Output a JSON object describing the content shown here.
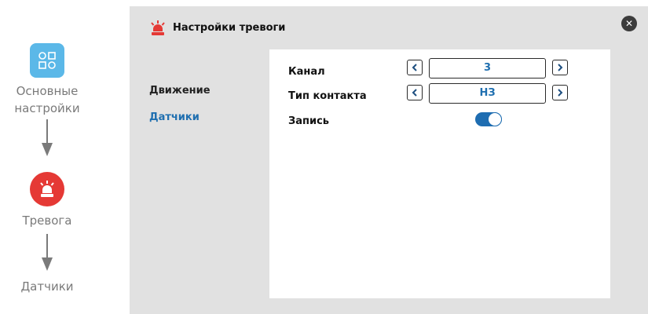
{
  "flow": {
    "steps": [
      {
        "label_line1": "Основные",
        "label_line2": "настройки",
        "icon": "settings-grid-icon"
      },
      {
        "label": "Тревога",
        "icon": "siren-icon"
      },
      {
        "label": "Датчики"
      }
    ]
  },
  "dialog": {
    "title": "Настройки тревоги",
    "title_icon": "siren-icon",
    "close_icon": "close-icon"
  },
  "menu": {
    "items": [
      {
        "label": "Движение",
        "active": false
      },
      {
        "label": "Датчики",
        "active": true
      }
    ]
  },
  "settings": {
    "channel": {
      "label": "Канал",
      "value": "3"
    },
    "contact_type": {
      "label": "Тип контакта",
      "value": "НЗ"
    },
    "record": {
      "label": "Запись",
      "enabled": true
    }
  },
  "colors": {
    "accent": "#1e6db1",
    "alarm": "#e53935",
    "settings_icon": "#5bb8e8",
    "panel_bg": "#e1e1e1"
  }
}
